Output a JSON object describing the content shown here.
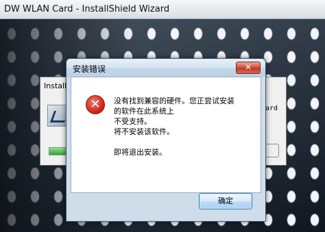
{
  "installer": {
    "title": "DW WLAN Card - InstallShield Wizard",
    "progress_label": "InstallShield",
    "progress_right_text": "ard",
    "progress_value": 0.25
  },
  "dialog": {
    "title": "安装错误",
    "close_label": "✕",
    "icon": "error-icon",
    "message_lines": [
      "没有找到兼容的硬件。您正尝试安装",
      "的软件在此系统上",
      "不受支持。",
      "将不安装该软件。",
      "",
      "即将退出安装。"
    ],
    "ok_label": "确定"
  }
}
